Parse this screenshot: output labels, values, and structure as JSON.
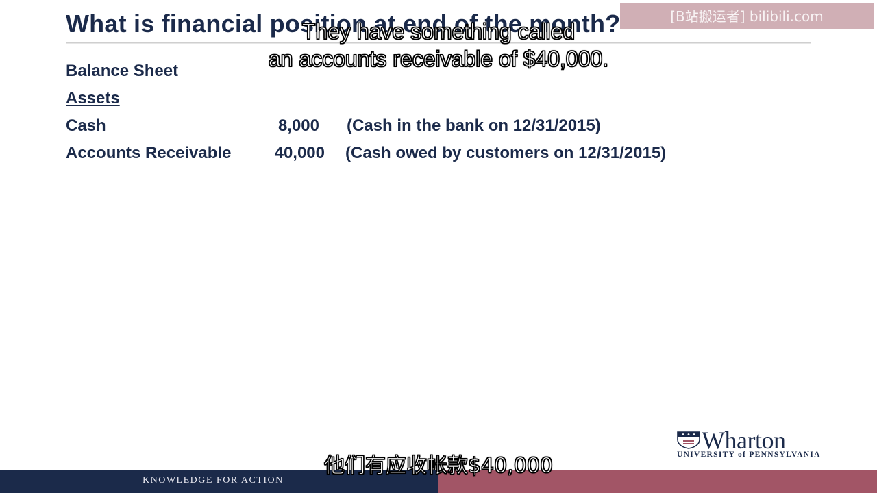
{
  "slide": {
    "title": "What is financial position at end of the month?",
    "balance_sheet_heading": "Balance Sheet",
    "assets_heading": "Assets",
    "rows": [
      {
        "label": "Cash",
        "amount": "8,000",
        "note": "(Cash in the bank on 12/31/2015)"
      },
      {
        "label": "Accounts Receivable",
        "amount": "40,000",
        "note": "(Cash owed by customers on 12/31/2015)"
      }
    ]
  },
  "subtitles": {
    "english_line1": "They have something called",
    "english_line2": "an accounts receivable of $40,000.",
    "chinese": "他们有应收帐款$40,000"
  },
  "watermark": "[B站搬运者] bilibili.com",
  "branding": {
    "logo_word": "Wharton",
    "logo_sub": "UNIVERSITY of PENNSYLVANIA",
    "tagline": "KNOWLEDGE FOR ACTION"
  },
  "colors": {
    "navy": "#1b2a4a",
    "footer_right": "#a25566",
    "watermark_bg": "#aa6e78"
  }
}
